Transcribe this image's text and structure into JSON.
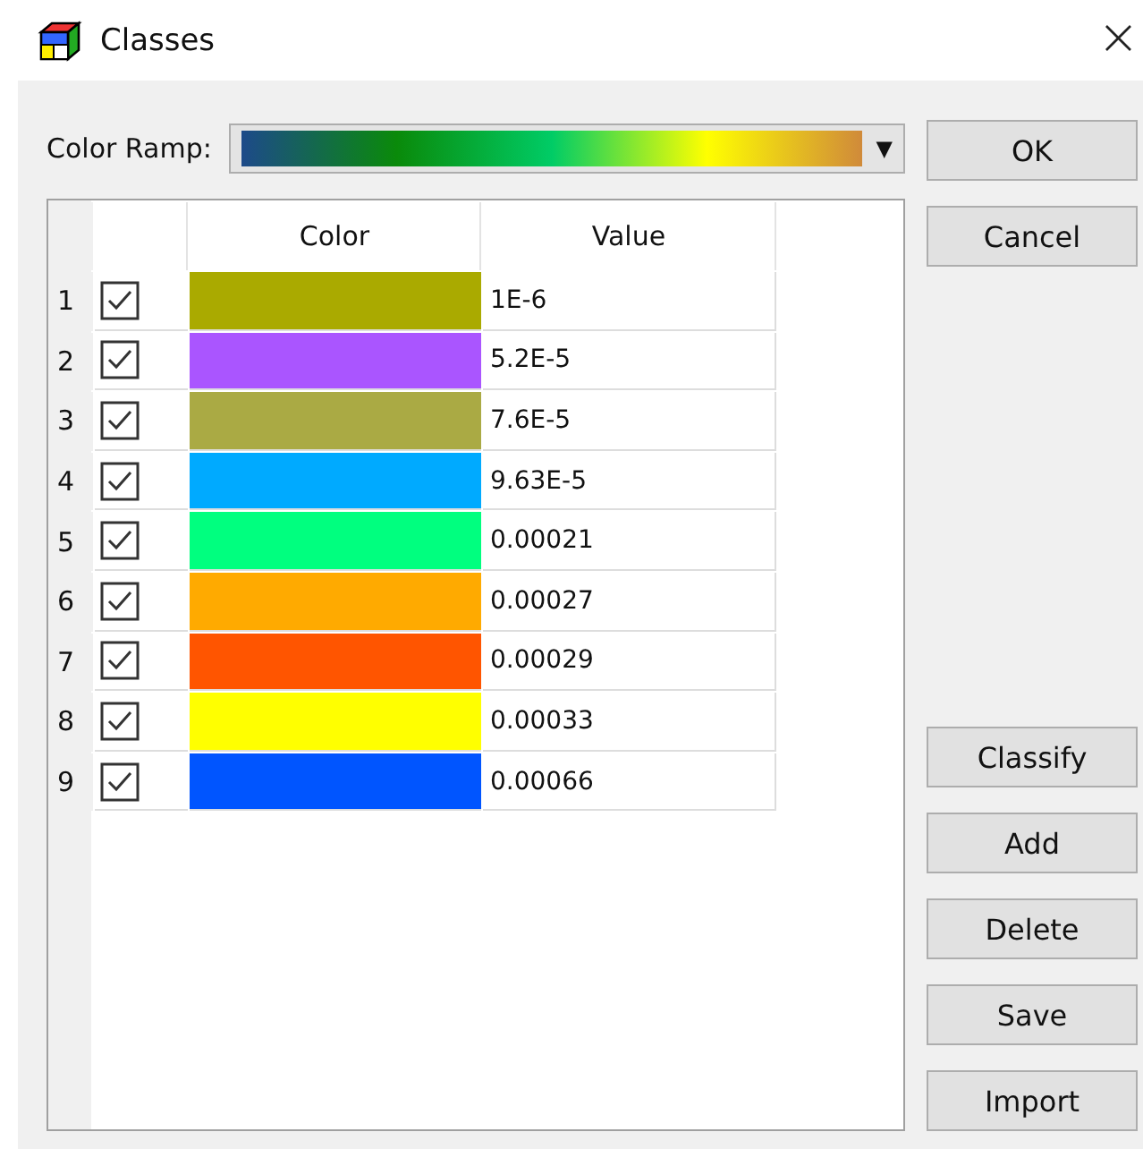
{
  "window": {
    "title": "Classes",
    "close": "×"
  },
  "color_ramp": {
    "label": "Color Ramp:",
    "dropdown_arrow": "▼"
  },
  "table": {
    "columns": [
      "Color",
      "Value"
    ],
    "rows": [
      {
        "index": "1",
        "checked": true,
        "color": "#aaaa00",
        "value": "1E-6"
      },
      {
        "index": "2",
        "checked": true,
        "color": "#aa55ff",
        "value": "5.2E-5"
      },
      {
        "index": "3",
        "checked": true,
        "color": "#aaaa44",
        "value": "7.6E-5"
      },
      {
        "index": "4",
        "checked": true,
        "color": "#00aaff",
        "value": "9.63E-5"
      },
      {
        "index": "5",
        "checked": true,
        "color": "#00ff7f",
        "value": "0.00021"
      },
      {
        "index": "6",
        "checked": true,
        "color": "#ffaa00",
        "value": "0.00027"
      },
      {
        "index": "7",
        "checked": true,
        "color": "#ff5500",
        "value": "0.00029"
      },
      {
        "index": "8",
        "checked": true,
        "color": "#ffff00",
        "value": "0.00033"
      },
      {
        "index": "9",
        "checked": true,
        "color": "#0055ff",
        "value": "0.00066"
      }
    ]
  },
  "buttons_top": [
    "OK",
    "Cancel"
  ],
  "buttons_bottom": [
    "Classify",
    "Add",
    "Delete",
    "Save",
    "Import"
  ]
}
